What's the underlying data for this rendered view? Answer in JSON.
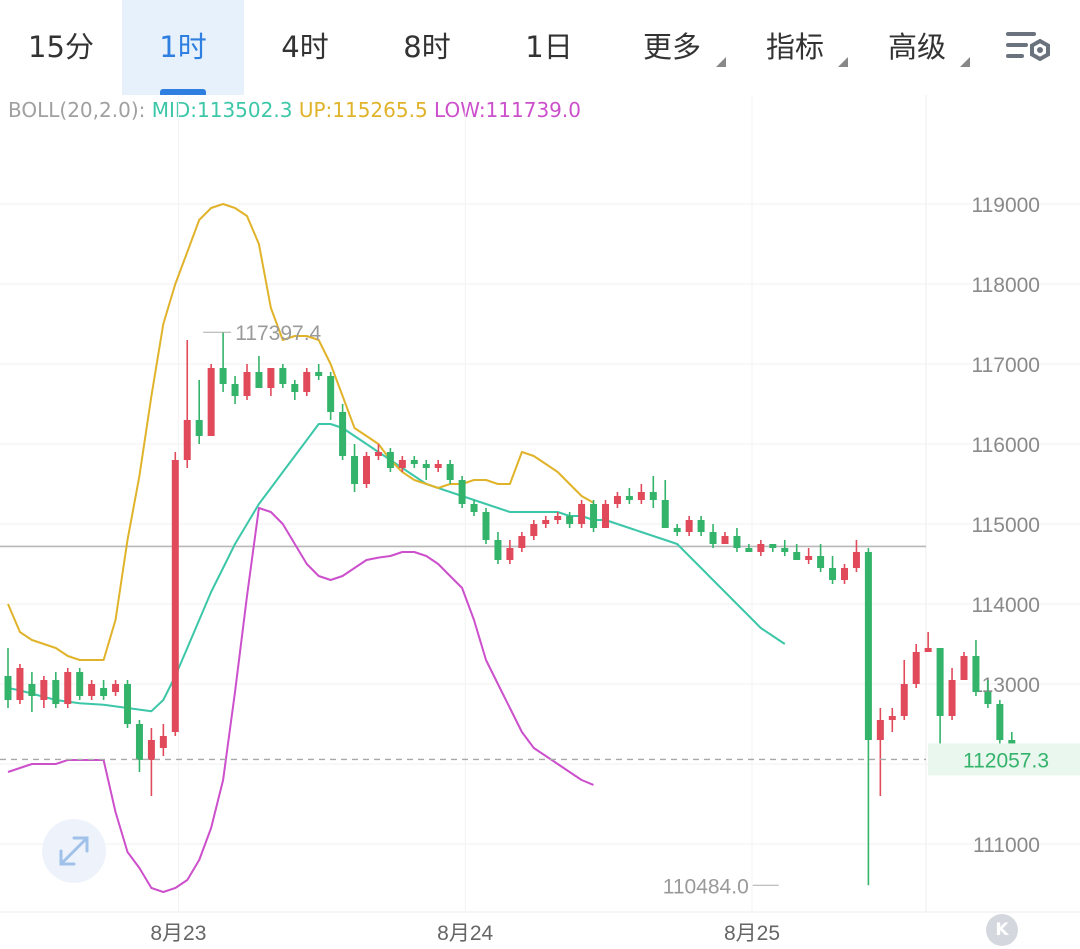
{
  "tabs": [
    {
      "label": "15分",
      "active": false,
      "dropdown": false
    },
    {
      "label": "1时",
      "active": true,
      "dropdown": false
    },
    {
      "label": "4时",
      "active": false,
      "dropdown": false
    },
    {
      "label": "8时",
      "active": false,
      "dropdown": false
    },
    {
      "label": "1日",
      "active": false,
      "dropdown": false
    },
    {
      "label": "更多",
      "active": false,
      "dropdown": true
    },
    {
      "label": "指标",
      "active": false,
      "dropdown": true
    },
    {
      "label": "高级",
      "active": false,
      "dropdown": true
    }
  ],
  "indicator": {
    "label": "BOLL(20,2.0):",
    "mid": "MID:113502.3",
    "up": "UP:115265.5",
    "low": "LOW:111739.0"
  },
  "expand_button": {
    "icon": "expand-icon"
  },
  "k_button": {
    "label": "K"
  },
  "colors": {
    "up_candle": "#e04a5a",
    "down_candle": "#34b36b",
    "mid_line": "#3cc7a8",
    "up_line": "#e0b32a",
    "low_line": "#cc4fcc",
    "accent": "#2f7fe0",
    "last_price": "#34b36b"
  },
  "chart_data": {
    "type": "candlestick",
    "indicator": "BOLL(20,2.0)",
    "ylim": [
      110200,
      120100
    ],
    "y_ticks": [
      111000,
      112000,
      113000,
      114000,
      115000,
      116000,
      117000,
      118000,
      119000
    ],
    "y_tick_labels": [
      "111000",
      "113000",
      "114000",
      "115000",
      "116000",
      "117000",
      "118000",
      "119000"
    ],
    "x_labels": [
      {
        "label": "8月23",
        "index": 12
      },
      {
        "label": "8月24",
        "index": 36
      },
      {
        "label": "8月25",
        "index": 60
      }
    ],
    "annotations": {
      "high": {
        "value": 117397.4,
        "label": "117397.4",
        "index": 16
      },
      "low": {
        "value": 110484.0,
        "label": "110484.0",
        "index": 65
      },
      "last_price": {
        "value": 112057.3,
        "label": "112057.3"
      },
      "ref_line": 114720
    },
    "candles": [
      [
        113100,
        112800,
        113450,
        112700
      ],
      [
        112800,
        113200,
        113250,
        112750
      ],
      [
        113000,
        112850,
        113150,
        112650
      ],
      [
        112800,
        113050,
        113100,
        112700
      ],
      [
        113050,
        112750,
        113150,
        112700
      ],
      [
        112750,
        113150,
        113200,
        112700
      ],
      [
        113150,
        112850,
        113200,
        112800
      ],
      [
        112850,
        113000,
        113050,
        112800
      ],
      [
        112950,
        112850,
        113050,
        112800
      ],
      [
        112900,
        113000,
        113050,
        112850
      ],
      [
        113000,
        112500,
        113050,
        112450
      ],
      [
        112500,
        112050,
        112550,
        111900
      ],
      [
        112050,
        112300,
        112450,
        111600
      ],
      [
        112200,
        112350,
        112500,
        112100
      ],
      [
        112400,
        115800,
        115900,
        112350
      ],
      [
        115800,
        116300,
        117300,
        115700
      ],
      [
        116300,
        116100,
        116800,
        116000
      ],
      [
        116100,
        116950,
        117000,
        116100
      ],
      [
        116950,
        116750,
        117397.4,
        116650
      ],
      [
        116750,
        116600,
        116850,
        116500
      ],
      [
        116600,
        116900,
        117000,
        116550
      ],
      [
        116900,
        116700,
        117100,
        116700
      ],
      [
        116700,
        116950,
        116950,
        116600
      ],
      [
        116950,
        116750,
        117000,
        116700
      ],
      [
        116750,
        116650,
        116800,
        116550
      ],
      [
        116650,
        116900,
        116950,
        116600
      ],
      [
        116900,
        116850,
        117000,
        116800
      ],
      [
        116850,
        116400,
        116900,
        116300
      ],
      [
        116400,
        115850,
        116500,
        115800
      ],
      [
        115850,
        115500,
        116000,
        115400
      ],
      [
        115500,
        115850,
        115900,
        115450
      ],
      [
        115850,
        115900,
        116000,
        115800
      ],
      [
        115900,
        115700,
        115950,
        115650
      ],
      [
        115700,
        115800,
        115850,
        115650
      ],
      [
        115800,
        115750,
        115850,
        115700
      ],
      [
        115750,
        115700,
        115800,
        115550
      ],
      [
        115700,
        115750,
        115800,
        115650
      ],
      [
        115750,
        115550,
        115800,
        115500
      ],
      [
        115550,
        115250,
        115600,
        115200
      ],
      [
        115250,
        115150,
        115300,
        115100
      ],
      [
        115150,
        114800,
        115200,
        114750
      ],
      [
        114800,
        114550,
        114900,
        114500
      ],
      [
        114550,
        114700,
        114800,
        114500
      ],
      [
        114700,
        114850,
        114900,
        114650
      ],
      [
        114850,
        115000,
        115050,
        114800
      ],
      [
        115000,
        115050,
        115100,
        114950
      ],
      [
        115050,
        115100,
        115150,
        115000
      ],
      [
        115100,
        115000,
        115150,
        114950
      ],
      [
        115000,
        115250,
        115300,
        114950
      ],
      [
        115250,
        114950,
        115300,
        114900
      ],
      [
        114950,
        115250,
        115300,
        114950
      ],
      [
        115250,
        115350,
        115400,
        115200
      ],
      [
        115350,
        115300,
        115450,
        115250
      ],
      [
        115300,
        115400,
        115500,
        115250
      ],
      [
        115400,
        115300,
        115600,
        115200
      ],
      [
        115300,
        114950,
        115550,
        114950
      ],
      [
        114950,
        114900,
        115000,
        114850
      ],
      [
        114900,
        115050,
        115100,
        114850
      ],
      [
        115050,
        114900,
        115100,
        114850
      ],
      [
        114900,
        114750,
        115000,
        114700
      ],
      [
        114750,
        114850,
        114900,
        114750
      ],
      [
        114850,
        114700,
        114950,
        114650
      ],
      [
        114700,
        114650,
        114750,
        114650
      ],
      [
        114650,
        114750,
        114800,
        114600
      ],
      [
        114750,
        114700,
        114750,
        114650
      ],
      [
        114700,
        114650,
        114800,
        114600
      ],
      [
        114650,
        114550,
        114750,
        114550
      ],
      [
        114550,
        114600,
        114700,
        114500
      ],
      [
        114600,
        114450,
        114750,
        114400
      ],
      [
        114450,
        114300,
        114600,
        114250
      ],
      [
        114300,
        114450,
        114500,
        114250
      ],
      [
        114450,
        114650,
        114800,
        114400
      ],
      [
        114650,
        112300,
        114700,
        110484.0
      ],
      [
        112300,
        112550,
        112700,
        111600
      ],
      [
        112550,
        112600,
        112700,
        112400
      ],
      [
        112600,
        113000,
        113300,
        112550
      ],
      [
        113000,
        113400,
        113500,
        112950
      ],
      [
        113400,
        113450,
        113650,
        113400
      ],
      [
        113450,
        112600,
        113450,
        112100
      ],
      [
        112600,
        113050,
        113200,
        112550
      ],
      [
        113050,
        113350,
        113400,
        113050
      ],
      [
        113350,
        112900,
        113550,
        112850
      ],
      [
        112900,
        112750,
        113050,
        112700
      ],
      [
        112750,
        112300,
        112800,
        112250
      ],
      [
        112300,
        112057.3,
        112400,
        112000
      ]
    ],
    "series": [
      {
        "name": "MID",
        "values": [
          112950,
          112920,
          112880,
          112840,
          112800,
          112780,
          112760,
          112750,
          112740,
          112720,
          112700,
          112680,
          112660,
          112800,
          113100,
          113450,
          113800,
          114150,
          114450,
          114750,
          115000,
          115250,
          115450,
          115650,
          115850,
          116050,
          116250,
          116250,
          116200,
          116100,
          116000,
          115900,
          115800,
          115700,
          115600,
          115500,
          115450,
          115400,
          115350,
          115300,
          115250,
          115200,
          115150,
          115150,
          115150,
          115150,
          115150,
          115100,
          115100,
          115050,
          115050,
          115000,
          114950,
          114900,
          114850,
          114800,
          114750,
          114600,
          114450,
          114300,
          114150,
          114000,
          113850,
          113700,
          113600,
          113500
        ]
      },
      {
        "name": "UP",
        "values": [
          114000,
          113650,
          113550,
          113500,
          113450,
          113350,
          113300,
          113300,
          113300,
          113800,
          114800,
          115600,
          116600,
          117500,
          118000,
          118400,
          118800,
          118950,
          119000,
          118950,
          118850,
          118500,
          117700,
          117300,
          117350,
          117350,
          117300,
          117000,
          116600,
          116200,
          116100,
          116000,
          115800,
          115650,
          115550,
          115500,
          115450,
          115500,
          115500,
          115550,
          115550,
          115500,
          115500,
          115900,
          115850,
          115750,
          115650,
          115500,
          115350,
          115265.5
        ]
      },
      {
        "name": "LOW",
        "values": [
          111900,
          111950,
          112000,
          112000,
          112000,
          112050,
          112050,
          112050,
          112050,
          111400,
          110900,
          110700,
          110450,
          110400,
          110450,
          110550,
          110800,
          111200,
          111800,
          112900,
          114100,
          115200,
          115150,
          115000,
          114750,
          114500,
          114350,
          114300,
          114350,
          114450,
          114550,
          114580,
          114600,
          114650,
          114650,
          114600,
          114500,
          114350,
          114200,
          113800,
          113300,
          113000,
          112700,
          112400,
          112200,
          112100,
          112000,
          111900,
          111800,
          111739.0
        ]
      }
    ]
  }
}
